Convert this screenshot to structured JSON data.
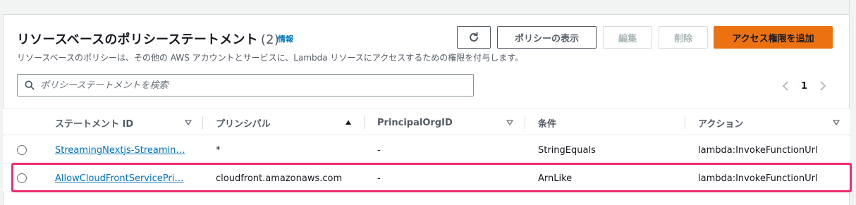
{
  "section": {
    "title": "リソースベースのポリシーステートメント",
    "count": "(2)",
    "info_link": "情報",
    "description": "リソースベースのポリシーは、その他の AWS アカウントとサービスに、Lambda リソースにアクセスするための権限を付与します。"
  },
  "toolbar": {
    "refresh_icon": "refresh-icon",
    "view_policy_label": "ポリシーの表示",
    "edit_label": "編集",
    "delete_label": "削除",
    "add_permission_label": "アクセス権限を追加"
  },
  "search": {
    "placeholder": "ポリシーステートメントを検索",
    "icon": "search-icon"
  },
  "pagination": {
    "current_page": "1",
    "prev_icon": "chevron-left-icon",
    "next_icon": "chevron-right-icon"
  },
  "table": {
    "columns": [
      {
        "label": "ステートメント ID",
        "sort": "none"
      },
      {
        "label": "プリンシパル",
        "sort": "ascending"
      },
      {
        "label": "PrincipalOrgID",
        "sort": "none"
      },
      {
        "label": "条件",
        "sort": "none"
      },
      {
        "label": "アクション",
        "sort": "none"
      }
    ],
    "rows": [
      {
        "statement_id": "StreamingNextjs-Streamin…",
        "principal": "*",
        "principal_org_id": "-",
        "condition": "StringEquals",
        "action": "lambda:InvokeFunctionUrl",
        "selected": false
      },
      {
        "statement_id": "AllowCloudFrontServicePri…",
        "principal": "cloudfront.amazonaws.com",
        "principal_org_id": "-",
        "condition": "ArnLike",
        "action": "lambda:InvokeFunctionUrl",
        "selected": false,
        "highlighted": true
      }
    ]
  },
  "colors": {
    "primary_button": "#ec7211",
    "link": "#0073bb",
    "highlight_border": "#ee2d6e"
  }
}
